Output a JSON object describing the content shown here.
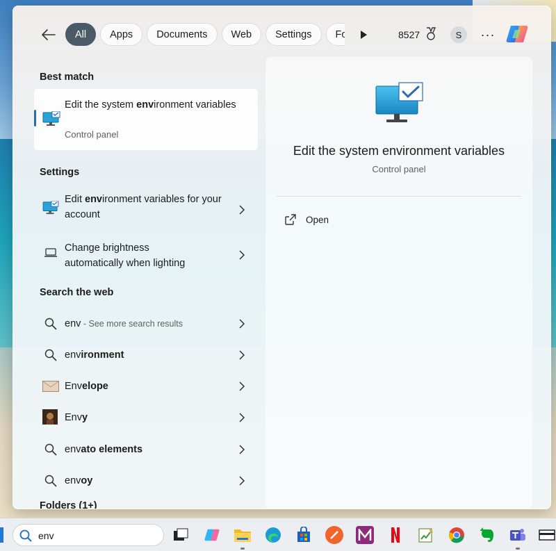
{
  "filters": [
    {
      "label": "All",
      "active": true
    },
    {
      "label": "Apps",
      "active": false
    },
    {
      "label": "Documents",
      "active": false
    },
    {
      "label": "Web",
      "active": false
    },
    {
      "label": "Settings",
      "active": false
    },
    {
      "label": "Folders",
      "active": false
    }
  ],
  "header": {
    "points": "8527",
    "avatar_initial": "S"
  },
  "best_match": {
    "section_title": "Best match",
    "title_pre": "Edit the system ",
    "title_bold": "env",
    "title_post": "ironment variables",
    "subtitle": "Control panel"
  },
  "settings": {
    "section_title": "Settings",
    "items": [
      {
        "pre": "Edit ",
        "bold": "env",
        "post": "ironment variables for your account"
      },
      {
        "pre": "Change brightness automatically when lighting",
        "bold": "",
        "post": ""
      }
    ]
  },
  "web": {
    "section_title": "Search the web",
    "items": [
      {
        "pre": "",
        "bold": "",
        "post": "env",
        "hint": " - See more search results"
      },
      {
        "pre": "env",
        "bold": "ironment",
        "post": "",
        "hint": ""
      },
      {
        "pre": "Env",
        "bold": "elope",
        "post": "",
        "hint": ""
      },
      {
        "pre": "Env",
        "bold": "y",
        "post": "",
        "hint": ""
      },
      {
        "pre": "env",
        "bold": "ato elements",
        "post": "",
        "hint": ""
      },
      {
        "pre": "env",
        "bold": "oy",
        "post": "",
        "hint": ""
      }
    ]
  },
  "folders": {
    "section_title": "Folders (1+)"
  },
  "preview": {
    "title": "Edit the system environment variables",
    "subtitle": "Control panel",
    "open_label": "Open"
  },
  "taskbar": {
    "search_value": "env",
    "icons": [
      "task-view-icon",
      "copilot-icon",
      "file-explorer-icon",
      "edge-icon",
      "microsoft-store-icon",
      "app-orange-icon",
      "app-m-icon",
      "netflix-icon",
      "app-chart-icon",
      "chrome-icon",
      "evernote-icon",
      "teams-icon",
      "app-window-icon"
    ]
  },
  "colors": {
    "accent": "#2a6bb3",
    "active_chip": "#4a5a66"
  }
}
